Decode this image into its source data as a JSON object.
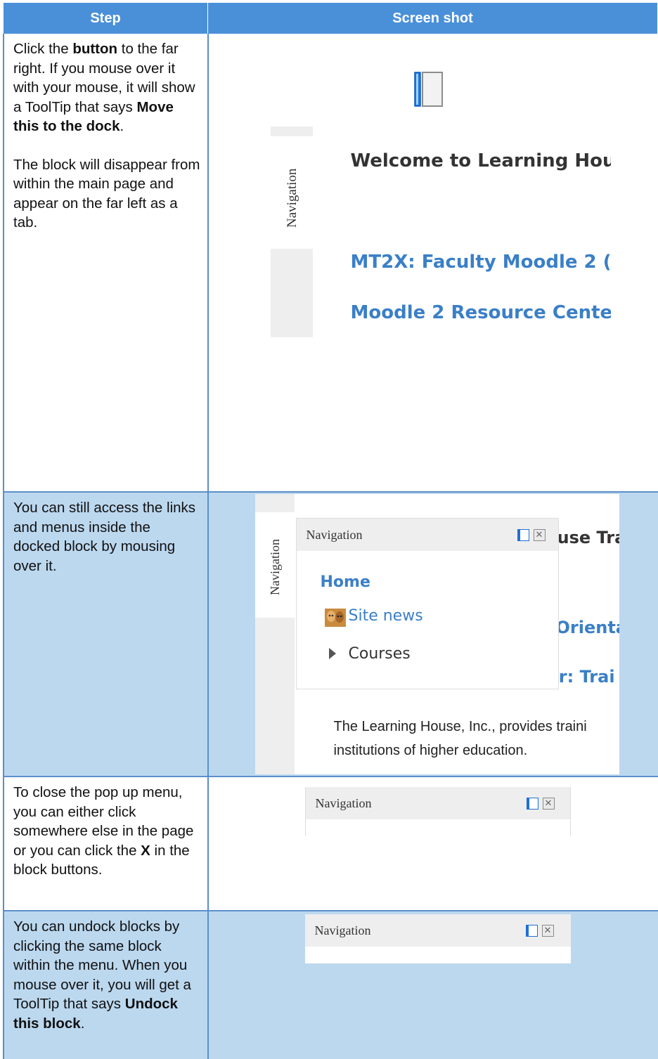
{
  "header": {
    "step": "Step",
    "screenshot": "Screen shot"
  },
  "rows": [
    {
      "step_html_parts": [
        "Click the ",
        "button",
        " to the far right. If you mouse over it with your mouse, it will show a ToolTip that says ",
        "Move this to the dock",
        "."
      ],
      "step_p2": "The block will disappear from within the main page and appear on the far left as a tab.",
      "shot": {
        "tab_label": "Navigation",
        "heading": "Welcome to Learning Hou",
        "link1": "MT2X: Faculty Moodle 2 (",
        "link2": "Moodle 2 Resource Cente"
      }
    },
    {
      "step": "You can still access the links and menus inside the docked block by mousing over it.",
      "shot": {
        "tab_label": "Navigation",
        "popup_title": "Navigation",
        "home": "Home",
        "site_news": "Site news",
        "courses": "Courses",
        "bg_heading_frag": "use Tra",
        "bg_link1_frag": "Orienta",
        "bg_link2_frag": "er: Trai",
        "body_line1": "The Learning House, Inc., provides traini",
        "body_line2": "institutions of higher education."
      }
    },
    {
      "step_parts": [
        "To close the pop up menu, you can either click somewhere else in the page or you can click the ",
        "X",
        " in the block buttons."
      ],
      "shot": {
        "popup_title": "Navigation"
      }
    },
    {
      "step_parts": [
        "You can undock blocks by clicking the same block within the menu. When you mouse over it, you will get a ToolTip that says ",
        "Undock this block",
        "."
      ],
      "shot": {
        "popup_title": "Navigation"
      }
    }
  ],
  "colors": {
    "header_bg": "#4a90d9",
    "row_blue": "#bcd8ef",
    "link": "#3a7fc7",
    "border": "#5b8fc9"
  },
  "icons": [
    "move-to-dock-icon",
    "close-icon",
    "expand-arrow-icon",
    "site-news-icon"
  ]
}
